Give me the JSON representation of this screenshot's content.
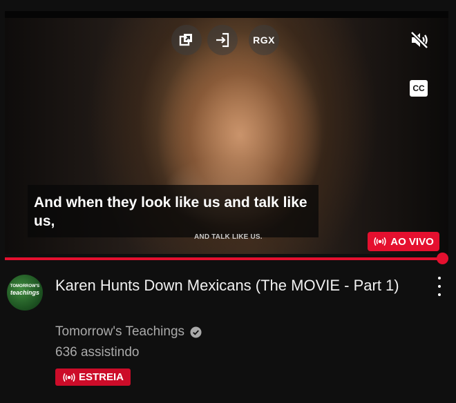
{
  "player": {
    "caption_text": "And when they look like us and talk like us,",
    "burned_in_text": "AND TALK LIKE US.",
    "rgx_label": "RGX",
    "cc_label": "CC",
    "live_label": "AO VIVO",
    "progress_fraction": 1.0,
    "accent_color": "#e5102f"
  },
  "video": {
    "title": "Karen Hunts Down Mexicans (The MOVIE - Part 1)",
    "channel_name": "Tomorrow's Teachings",
    "viewers": "636 assistindo",
    "premiere_label": "ESTREIA",
    "avatar_text_top": "TOMORROW'S",
    "avatar_text_main": "teachings"
  },
  "icons": [
    "pip-icon",
    "enter-icon",
    "mute-icon",
    "captions-icon",
    "live-icon",
    "verified-icon",
    "more-icon"
  ]
}
